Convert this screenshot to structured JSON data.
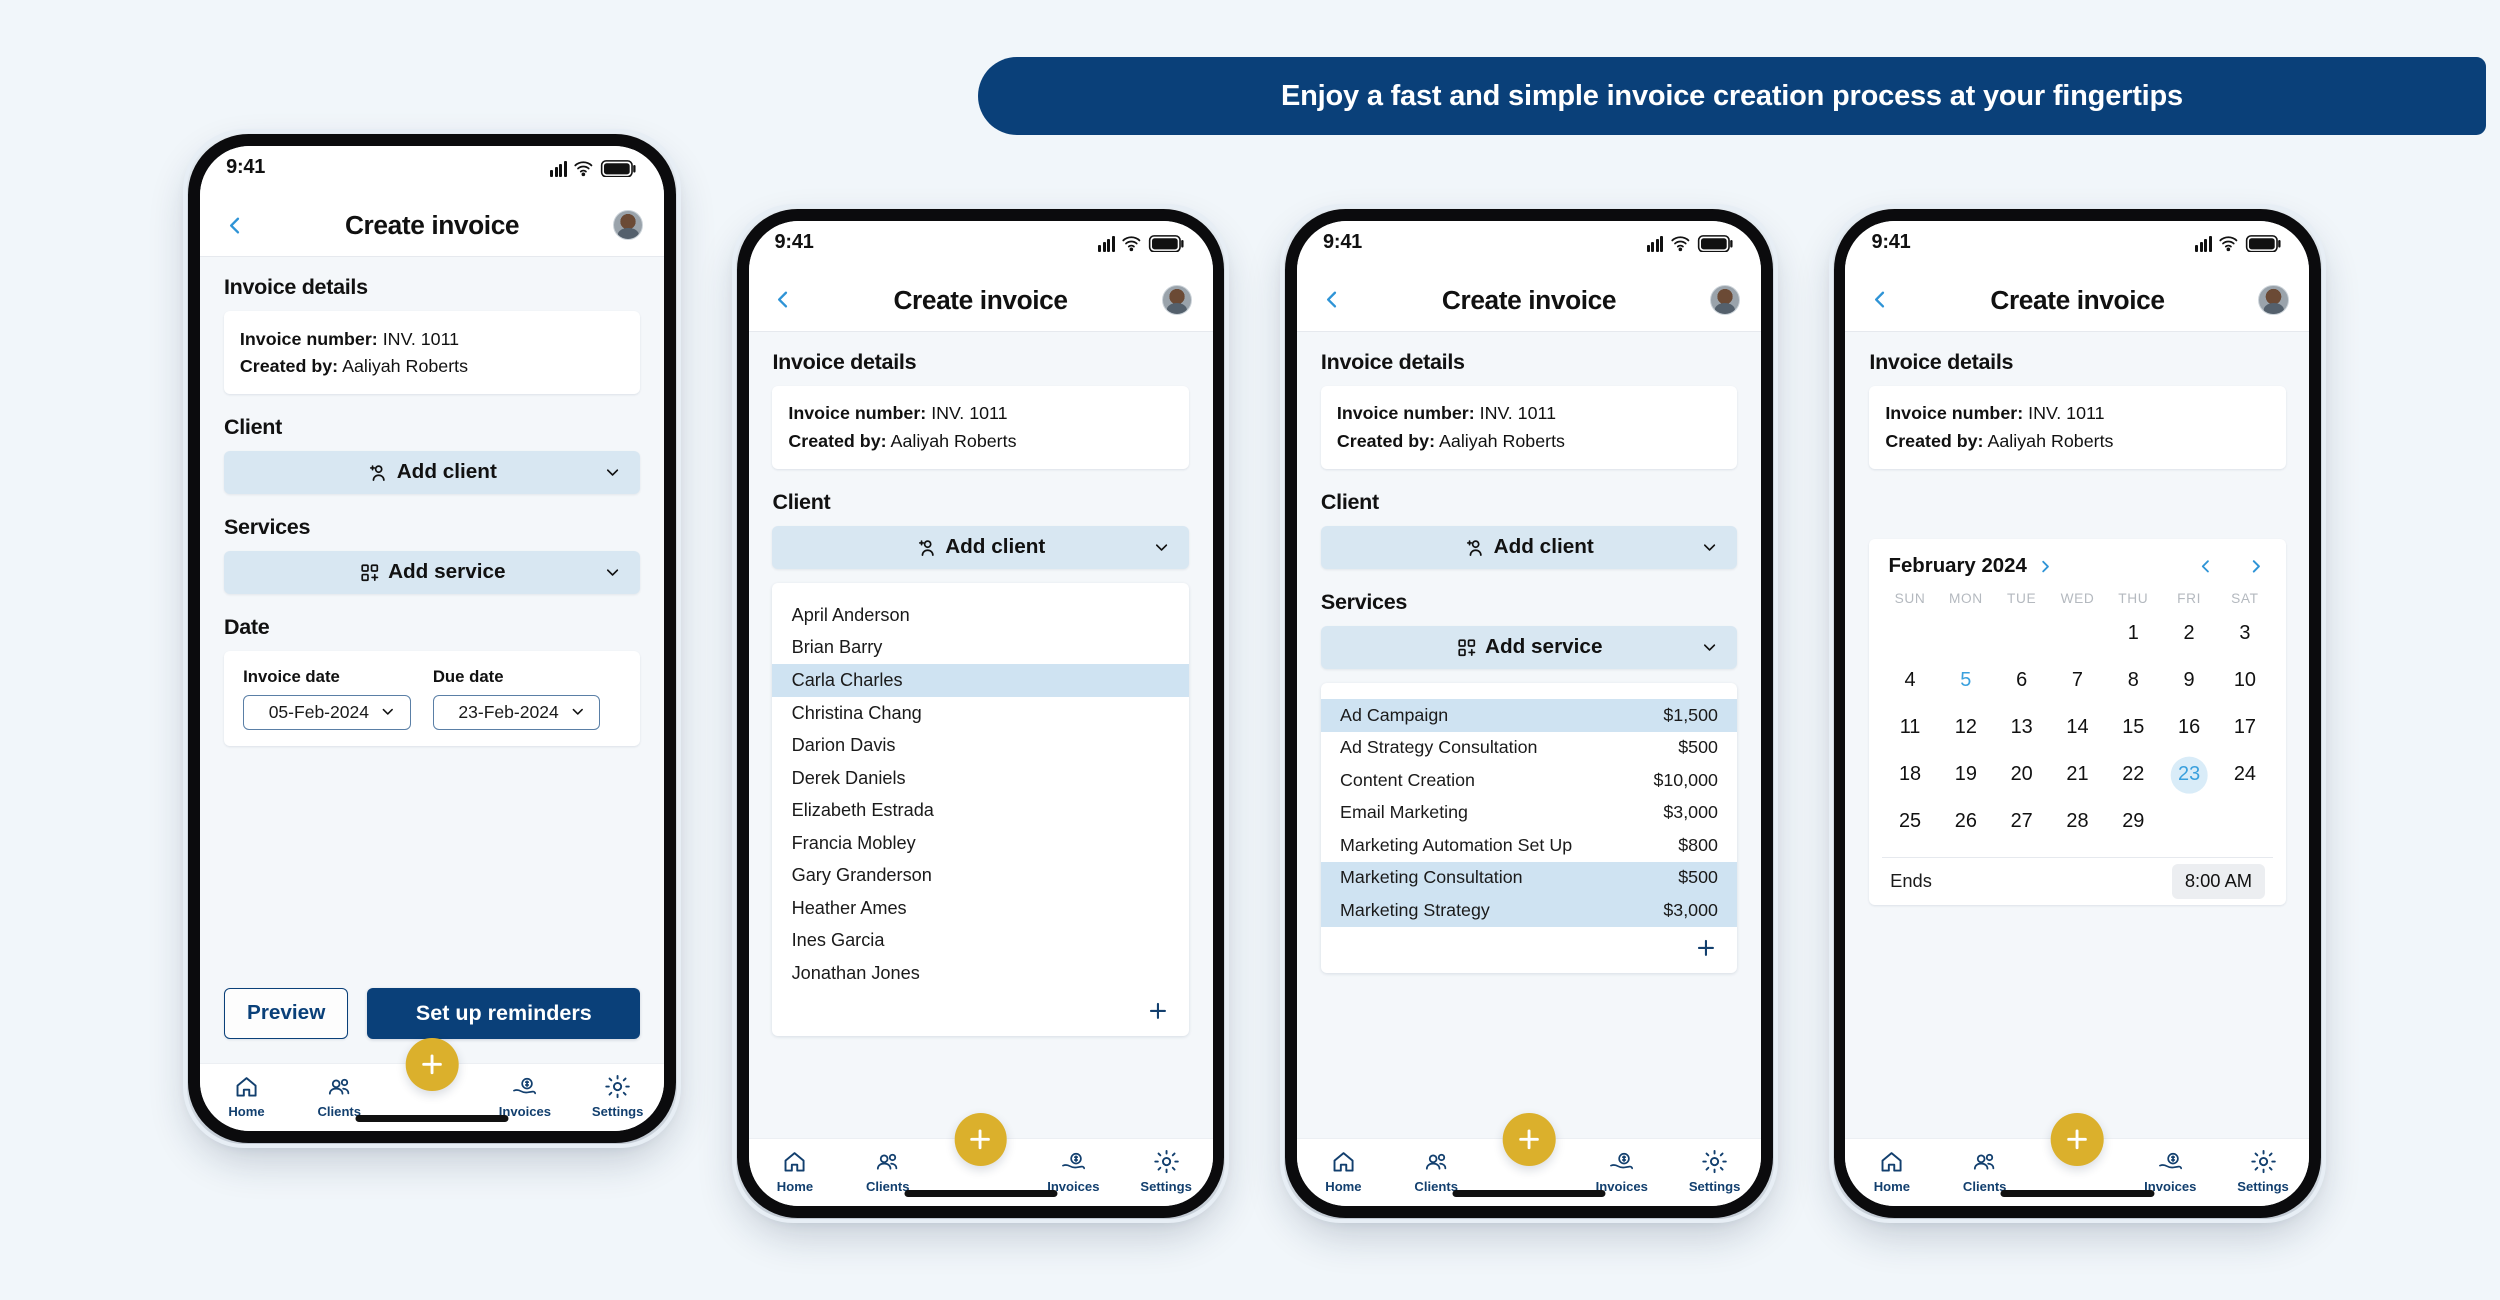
{
  "banner": {
    "text": "Enjoy a fast and simple invoice creation process at your fingertips",
    "color": "#0a4079"
  },
  "theme": {
    "background": "#f1f6fa",
    "navy": "#0a4079",
    "gold": "#dbb02c",
    "light_blue_button": "#d8e7f2",
    "selection_blue": "#cfe3f2",
    "accent_blue": "#2f94d6"
  },
  "status_bar": {
    "time": "9:41",
    "signal_icon": "cellular-bars-icon",
    "wifi_icon": "wifi-icon",
    "battery_icon": "battery-icon"
  },
  "nav": {
    "title": "Create invoice",
    "back_icon": "chevron-left-icon",
    "avatar_icon": "user-avatar"
  },
  "invoice_details": {
    "heading": "Invoice details",
    "number_label": "Invoice number:",
    "number_value": "INV. 1011",
    "created_label": "Created by:",
    "created_value": "Aaliyah Roberts"
  },
  "client_section": {
    "heading": "Client",
    "button_label": "Add client",
    "button_icon": "add-person-icon",
    "chevron_icon": "chevron-down-icon"
  },
  "services_section": {
    "heading": "Services",
    "button_label": "Add service",
    "button_icon": "add-grid-icon",
    "chevron_icon": "chevron-down-icon"
  },
  "date_section": {
    "heading": "Date",
    "invoice_date_label": "Invoice date",
    "invoice_date_value": "05-Feb-2024",
    "due_date_label": "Due date",
    "due_date_value": "23-Feb-2024",
    "chevron_icon": "chevron-down-icon"
  },
  "actions": {
    "preview": "Preview",
    "set_up_reminders": "Set up reminders"
  },
  "client_list": {
    "add_icon": "plus-icon",
    "selected": "Carla Charles",
    "items": [
      "April Anderson",
      "Brian Barry",
      "Carla Charles",
      "Christina Chang",
      "Darion Davis",
      "Derek Daniels",
      "Elizabeth Estrada",
      "Francia Mobley",
      "Gary Granderson",
      "Heather Ames",
      "Ines Garcia",
      "Jonathan Jones"
    ]
  },
  "service_list": {
    "add_icon": "plus-icon",
    "items": [
      {
        "name": "Ad Campaign",
        "price": "$1,500",
        "selected": true
      },
      {
        "name": "Ad Strategy Consultation",
        "price": "$500",
        "selected": false
      },
      {
        "name": "Content Creation",
        "price": "$10,000",
        "selected": false
      },
      {
        "name": "Email Marketing",
        "price": "$3,000",
        "selected": false
      },
      {
        "name": "Marketing Automation Set Up",
        "price": "$800",
        "selected": false
      },
      {
        "name": "Marketing Consultation",
        "price": "$500",
        "selected": true
      },
      {
        "name": "Marketing Strategy",
        "price": "$3,000",
        "selected": true
      }
    ]
  },
  "calendar": {
    "month_label": "February 2024",
    "month_chevron_icon": "chevron-right-icon",
    "prev_icon": "chevron-left-icon",
    "next_icon": "chevron-right-icon",
    "day_headers": [
      "SUN",
      "MON",
      "TUE",
      "WED",
      "THU",
      "FRI",
      "SAT"
    ],
    "leading_blanks": 4,
    "days": [
      1,
      2,
      3,
      4,
      5,
      6,
      7,
      8,
      9,
      10,
      11,
      12,
      13,
      14,
      15,
      16,
      17,
      18,
      19,
      20,
      21,
      22,
      23,
      24,
      25,
      26,
      27,
      28,
      29
    ],
    "accent_day": 5,
    "selected_day": 23,
    "ends_label": "Ends",
    "ends_value": "8:00 AM"
  },
  "tabbar": {
    "fab_icon": "plus-icon",
    "items": [
      {
        "label": "Home",
        "icon": "home-icon"
      },
      {
        "label": "Clients",
        "icon": "people-icon"
      },
      {
        "label": "Invoices",
        "icon": "hand-money-icon"
      },
      {
        "label": "Settings",
        "icon": "gear-icon"
      }
    ]
  }
}
